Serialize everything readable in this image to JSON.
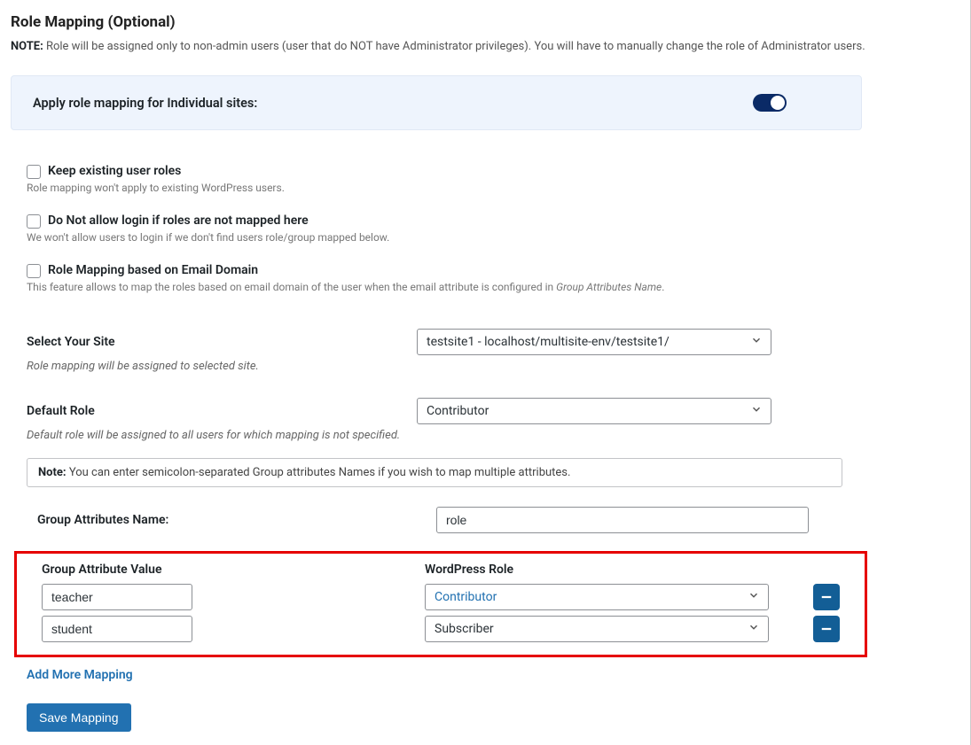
{
  "title": "Role Mapping (Optional)",
  "note_prefix": "NOTE:",
  "note_text": " Role will be assigned only to non-admin users (user that do NOT have Administrator privileges). You will have to manually change the role of Administrator users.",
  "toggle_label": "Apply role mapping for Individual sites:",
  "checkboxes": {
    "keep_existing": {
      "label": "Keep existing user roles",
      "hint": "Role mapping won't apply to existing WordPress users."
    },
    "no_login": {
      "label": "Do Not allow login if roles are not mapped here",
      "hint": "We won't allow users to login if we don't find users role/group mapped below."
    },
    "email_domain": {
      "label": "Role Mapping based on Email Domain",
      "hint_prefix": "This feature allows to map the roles based on email domain of the user when the email attribute is configured in ",
      "hint_italic": "Group Attributes Name",
      "hint_suffix": "."
    }
  },
  "site_select": {
    "label": "Select Your Site",
    "value": "testsite1 - localhost/multisite-env/testsite1/",
    "hint": "Role mapping will be assigned to selected site."
  },
  "default_role": {
    "label": "Default Role",
    "value": "Contributor",
    "hint": "Default role will be assigned to all users for which mapping is not specified."
  },
  "info_note_prefix": "Note:",
  "info_note_text": " You can enter semicolon-separated Group attributes Names if you wish to map multiple attributes.",
  "group_attr": {
    "label": "Group Attributes Name:",
    "value": "role"
  },
  "mapping_headers": {
    "col1": "Group Attribute Value",
    "col2": "WordPress Role"
  },
  "mappings": [
    {
      "value": "teacher",
      "role": "Contributor",
      "highlighted": true
    },
    {
      "value": "student",
      "role": "Subscriber",
      "highlighted": false
    }
  ],
  "add_more_label": "Add More Mapping",
  "save_label": "Save Mapping"
}
